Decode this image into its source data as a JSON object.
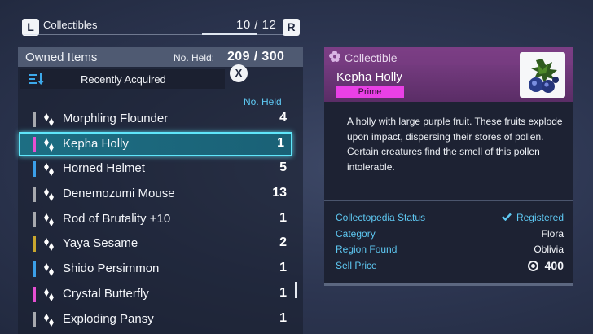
{
  "header": {
    "left_button": "L",
    "right_button": "R",
    "title": "Collectibles",
    "page_count": "10 / 12"
  },
  "list": {
    "title": "Owned Items",
    "held_label": "No. Held:",
    "held_value": "209 / 300",
    "sort_label": "Recently Acquired",
    "close_button": "X",
    "column_header": "No. Held",
    "items": [
      {
        "name": "Morphling Flounder",
        "qty": "4",
        "rarity_color": "#a7a9ae"
      },
      {
        "name": "Kepha Holly",
        "qty": "1",
        "rarity_color": "#e64fd2",
        "selected": true
      },
      {
        "name": "Horned Helmet",
        "qty": "5",
        "rarity_color": "#3b9fe8"
      },
      {
        "name": "Denemozumi Mouse",
        "qty": "13",
        "rarity_color": "#a7a9ae"
      },
      {
        "name": "Rod of Brutality +10",
        "qty": "1",
        "rarity_color": "#a7a9ae"
      },
      {
        "name": "Yaya Sesame",
        "qty": "2",
        "rarity_color": "#c9a62e"
      },
      {
        "name": "Shido Persimmon",
        "qty": "1",
        "rarity_color": "#3b9fe8"
      },
      {
        "name": "Crystal Butterfly",
        "qty": "1",
        "rarity_color": "#e64fd2"
      },
      {
        "name": "Exploding Pansy",
        "qty": "1",
        "rarity_color": "#a7a9ae"
      }
    ]
  },
  "detail": {
    "type": "Collectible",
    "name": "Kepha Holly",
    "badge": "Prime",
    "image_icon": "holly-berry-icon",
    "description": "A holly with large purple fruit. These fruits explode upon impact, dispersing their stores of pollen. Certain creatures find the smell of this pollen intolerable.",
    "stats": {
      "collectopedia_label": "Collectopedia Status",
      "collectopedia_value": "Registered",
      "category_label": "Category",
      "category_value": "Flora",
      "region_label": "Region Found",
      "region_value": "Oblivia",
      "price_label": "Sell Price",
      "price_value": "400"
    }
  },
  "colors": {
    "accent": "#5ec8f2",
    "selected_border": "#5fe6fa",
    "prime": "#ea40e6",
    "header_purple": "#80418a"
  }
}
